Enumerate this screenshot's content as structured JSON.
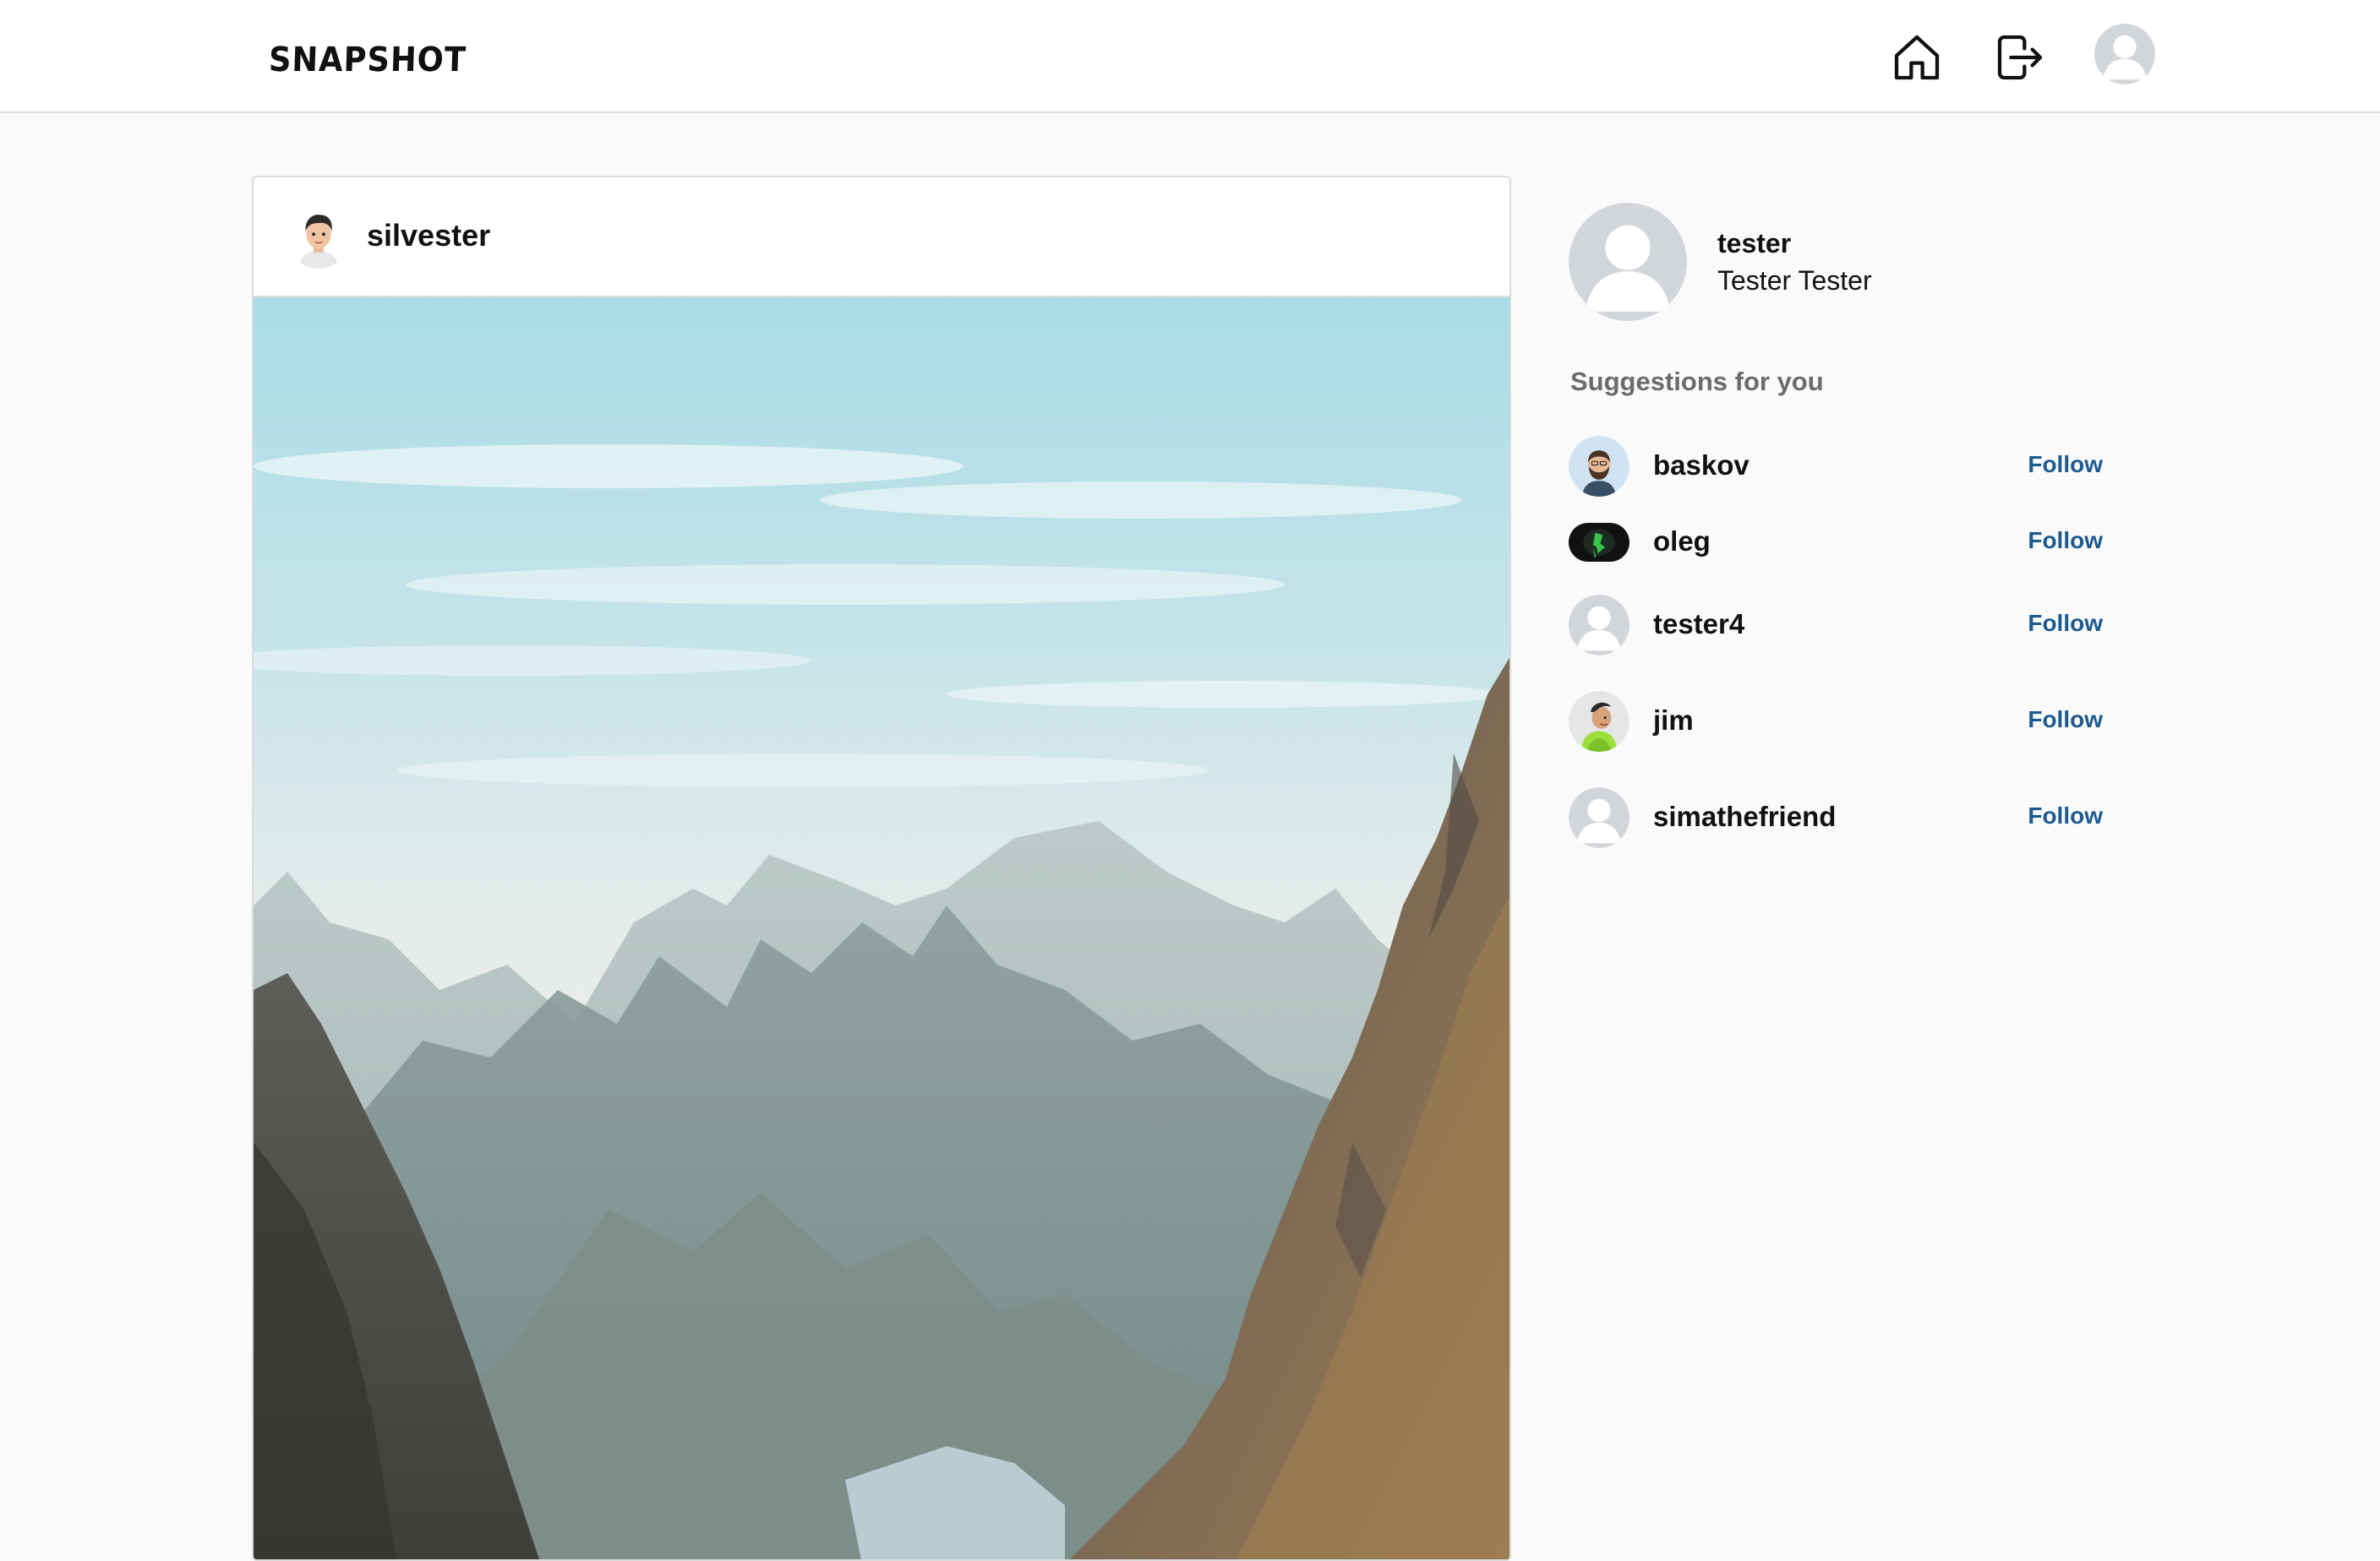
{
  "header": {
    "logo": "SNAPSHOT",
    "home_icon": "home-icon",
    "logout_icon": "logout-icon",
    "profile_icon": "default-avatar-icon"
  },
  "post": {
    "username": "silvester",
    "avatar": "cartoon-man-avatar",
    "image": "mountain-landscape-photo"
  },
  "sidebar": {
    "profile": {
      "username": "tester",
      "full_name": "Tester Tester",
      "avatar": "default-avatar-icon"
    },
    "suggestions_title": "Suggestions for you",
    "suggestions": [
      {
        "username": "baskov",
        "follow_label": "Follow",
        "avatar": "bearded-man-avatar"
      },
      {
        "username": "oleg",
        "follow_label": "Follow",
        "avatar": "dark-green-figure-avatar"
      },
      {
        "username": "tester4",
        "follow_label": "Follow",
        "avatar": "default-avatar-icon"
      },
      {
        "username": "jim",
        "follow_label": "Follow",
        "avatar": "cartoon-character-avatar"
      },
      {
        "username": "simathefriend",
        "follow_label": "Follow",
        "avatar": "default-avatar-icon"
      }
    ]
  },
  "colors": {
    "background": "#fafafa",
    "border": "#dbdbdb",
    "follow": "#1c5a8f",
    "suggestions_title": "#6b6b6b"
  }
}
